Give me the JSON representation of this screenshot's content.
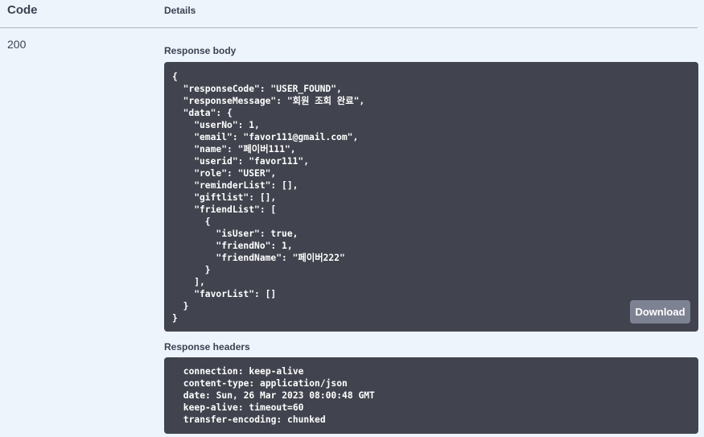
{
  "table": {
    "code_header": "Code",
    "details_header": "Details"
  },
  "response": {
    "status_code": "200",
    "body_label": "Response body",
    "body": "{\n  \"responseCode\": \"USER_FOUND\",\n  \"responseMessage\": \"회원 조회 완료\",\n  \"data\": {\n    \"userNo\": 1,\n    \"email\": \"favor111@gmail.com\",\n    \"name\": \"페이버111\",\n    \"userid\": \"favor111\",\n    \"role\": \"USER\",\n    \"reminderList\": [],\n    \"giftlist\": [],\n    \"friendList\": [\n      {\n        \"isUser\": true,\n        \"friendNo\": 1,\n        \"friendName\": \"페이버222\"\n      }\n    ],\n    \"favorList\": []\n  }\n}",
    "download_label": "Download",
    "headers_label": "Response headers",
    "headers": " connection: keep-alive \n content-type: application/json \n date: Sun, 26 Mar 2023 08:00:48 GMT \n keep-alive: timeout=60 \n transfer-encoding: chunked "
  }
}
